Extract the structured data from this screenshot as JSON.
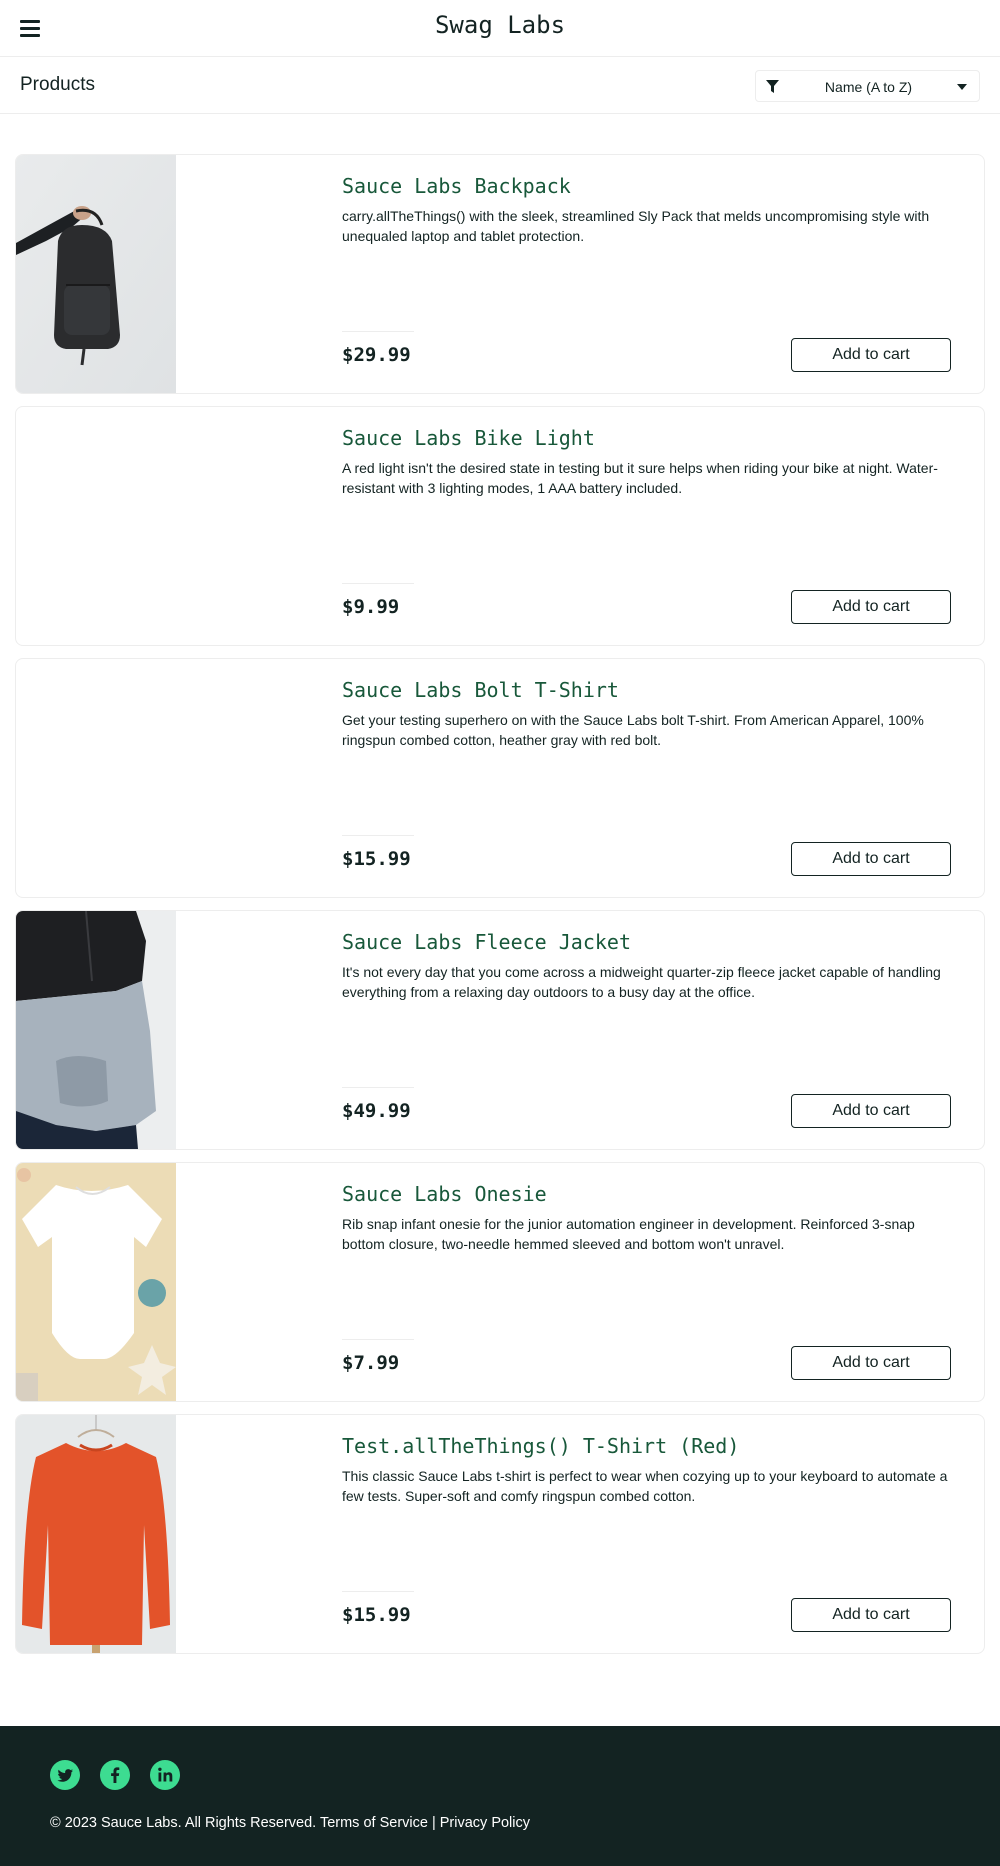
{
  "header": {
    "app_title": "Swag Labs",
    "menu_icon": "hamburger-menu-icon"
  },
  "subheader": {
    "title": "Products",
    "sort": {
      "selected": "Name (A to Z)",
      "icon": "filter-icon"
    }
  },
  "items": [
    {
      "name": "Sauce Labs Backpack",
      "desc": "carry.allTheThings() with the sleek, streamlined Sly Pack that melds uncompromising style with unequaled laptop and tablet protection.",
      "price": "$29.99",
      "button": "Add to cart"
    },
    {
      "name": "Sauce Labs Bike Light",
      "desc": "A red light isn't the desired state in testing but it sure helps when riding your bike at night. Water-resistant with 3 lighting modes, 1 AAA battery included.",
      "price": "$9.99",
      "button": "Add to cart"
    },
    {
      "name": "Sauce Labs Bolt T-Shirt",
      "desc": "Get your testing superhero on with the Sauce Labs bolt T-shirt. From American Apparel, 100% ringspun combed cotton, heather gray with red bolt.",
      "price": "$15.99",
      "button": "Add to cart"
    },
    {
      "name": "Sauce Labs Fleece Jacket",
      "desc": "It's not every day that you come across a midweight quarter-zip fleece jacket capable of handling everything from a relaxing day outdoors to a busy day at the office.",
      "price": "$49.99",
      "button": "Add to cart"
    },
    {
      "name": "Sauce Labs Onesie",
      "desc": "Rib snap infant onesie for the junior automation engineer in development. Reinforced 3-snap bottom closure, two-needle hemmed sleeved and bottom won't unravel.",
      "price": "$7.99",
      "button": "Add to cart"
    },
    {
      "name": "Test.allTheThings() T-Shirt (Red)",
      "desc": "This classic Sauce Labs t-shirt is perfect to wear when cozying up to your keyboard to automate a few tests. Super-soft and comfy ringspun combed cotton.",
      "price": "$15.99",
      "button": "Add to cart"
    }
  ],
  "footer": {
    "social": [
      "twitter-icon",
      "facebook-icon",
      "linkedin-icon"
    ],
    "copy": "© 2023 Sauce Labs. All Rights Reserved. Terms of Service | Privacy Policy"
  },
  "colors": {
    "accent": "#3ddc91",
    "dark": "#132322",
    "item_name": "#18583a",
    "border": "#ededed"
  }
}
